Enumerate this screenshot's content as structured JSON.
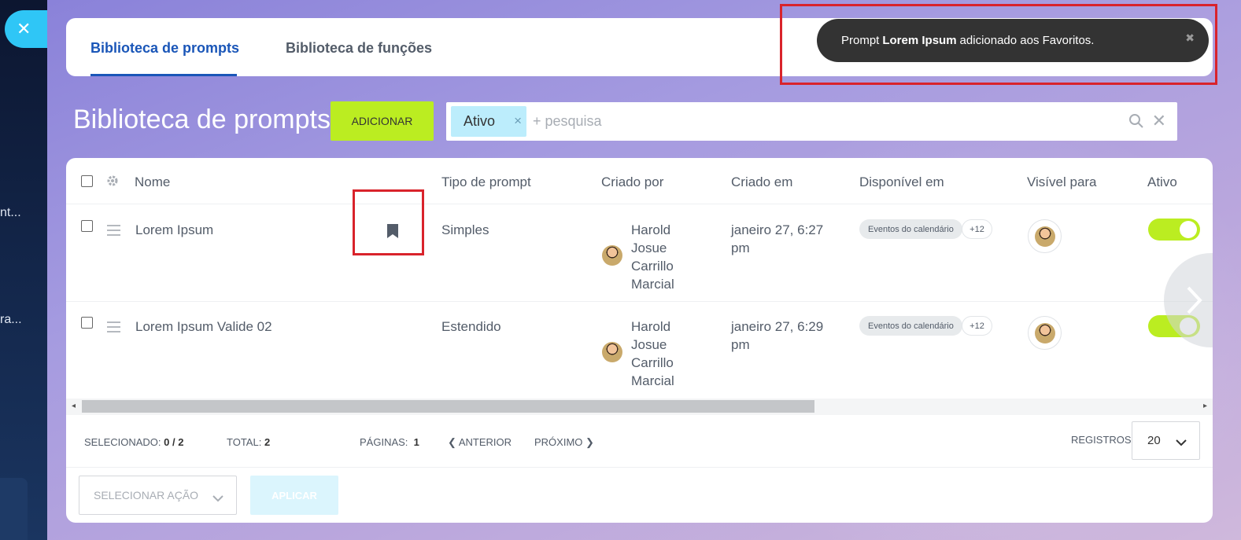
{
  "left_panel": {
    "fragments": [
      "nt...",
      "ra..."
    ]
  },
  "close_button": {
    "icon": "close-icon",
    "glyph": "✕"
  },
  "tabs": [
    {
      "label": "Biblioteca de prompts",
      "active": true
    },
    {
      "label": "Biblioteca de funções",
      "active": false
    }
  ],
  "toast": {
    "prefix": "Prompt",
    "bold": "Lorem Ipsum",
    "suffix": "adicionado aos Favoritos.",
    "close_glyph": "✖"
  },
  "page": {
    "title": "Biblioteca de prompts",
    "add_label": "ADICIONAR"
  },
  "search": {
    "filter_chip": "Ativo",
    "chip_remove": "×",
    "placeholder": "+ pesquisa",
    "clear_glyph": "✕"
  },
  "table": {
    "columns": [
      "Nome",
      "Tipo de prompt",
      "Criado por",
      "Criado em",
      "Disponível em",
      "Visível para",
      "Ativo"
    ],
    "rows": [
      {
        "name": "Lorem Ipsum",
        "favorite": true,
        "type": "Simples",
        "created_by": [
          "Harold",
          "Josue",
          "Carrillo",
          "Marcial"
        ],
        "created_at": [
          "janeiro 27, 6:27",
          "pm"
        ],
        "available_in": "Eventos do calendário",
        "available_more": "+12",
        "active": true
      },
      {
        "name": "Lorem Ipsum Valide 02",
        "favorite": false,
        "type": "Estendido",
        "created_by": [
          "Harold",
          "Josue",
          "Carrillo",
          "Marcial"
        ],
        "created_at": [
          "janeiro 27, 6:29",
          "pm"
        ],
        "available_in": "Eventos do calendário",
        "available_more": "+12",
        "active": true
      }
    ]
  },
  "footer": {
    "selected_label": "SELECIONADO:",
    "selected_value": "0 / 2",
    "total_label": "TOTAL:",
    "total_value": "2",
    "pages_label": "PÁGINAS:",
    "pages_value": "1",
    "prev_label": "ANTERIOR",
    "next_label": "PRÓXIMO",
    "records_label": "REGISTROS:",
    "records_value": "20",
    "action_placeholder": "SELECIONAR AÇÃO",
    "apply_label": "APLICAR"
  },
  "colors": {
    "accent_green": "#bbed21",
    "link_blue": "#1a56b8",
    "highlight_red": "#d9232b",
    "slider_blue": "#2fc6f6"
  }
}
